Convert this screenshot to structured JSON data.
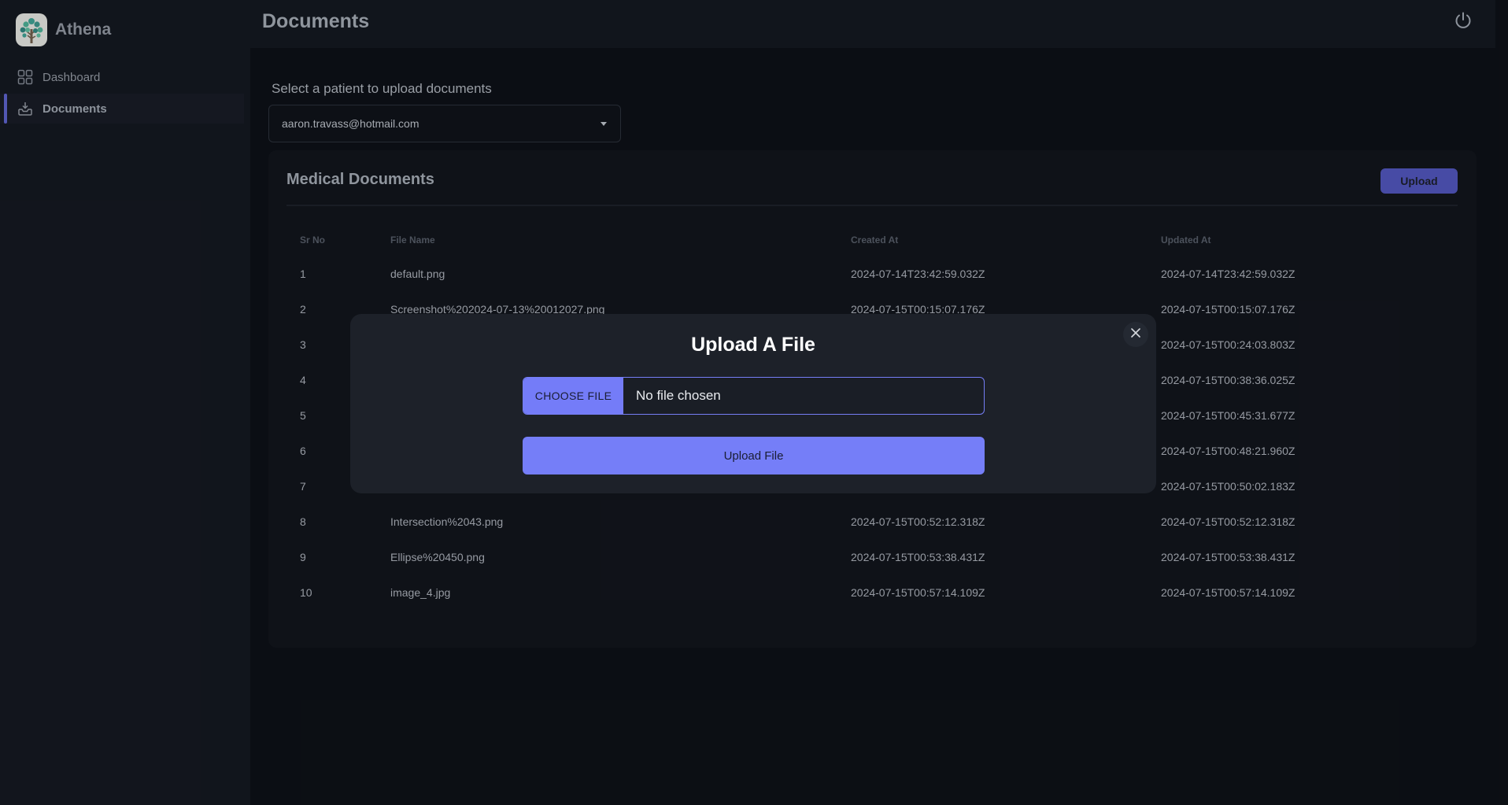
{
  "app": {
    "name": "Athena"
  },
  "sidebar": {
    "items": [
      {
        "label": "Dashboard",
        "icon": "grid-icon",
        "active": false
      },
      {
        "label": "Documents",
        "icon": "inbox-icon",
        "active": true
      }
    ]
  },
  "header": {
    "title": "Documents",
    "power_icon": "power-icon"
  },
  "patient_select": {
    "label": "Select a patient to upload documents",
    "value": "aaron.travass@hotmail.com"
  },
  "documents": {
    "title": "Medical Documents",
    "upload_label": "Upload",
    "columns": [
      "Sr No",
      "File Name",
      "Created At",
      "Updated At"
    ],
    "rows": [
      [
        "1",
        "default.png",
        "2024-07-14T23:42:59.032Z",
        "2024-07-14T23:42:59.032Z"
      ],
      [
        "2",
        "Screenshot%202024-07-13%20012027.png",
        "2024-07-15T00:15:07.176Z",
        "2024-07-15T00:15:07.176Z"
      ],
      [
        "3",
        "",
        "",
        "2024-07-15T00:24:03.803Z"
      ],
      [
        "4",
        "",
        "",
        "2024-07-15T00:38:36.025Z"
      ],
      [
        "5",
        "",
        "",
        "2024-07-15T00:45:31.677Z"
      ],
      [
        "6",
        "",
        "",
        "2024-07-15T00:48:21.960Z"
      ],
      [
        "7",
        "",
        "",
        "2024-07-15T00:50:02.183Z"
      ],
      [
        "8",
        "Intersection%2043.png",
        "2024-07-15T00:52:12.318Z",
        "2024-07-15T00:52:12.318Z"
      ],
      [
        "9",
        "Ellipse%20450.png",
        "2024-07-15T00:53:38.431Z",
        "2024-07-15T00:53:38.431Z"
      ],
      [
        "10",
        "image_4.jpg",
        "2024-07-15T00:57:14.109Z",
        "2024-07-15T00:57:14.109Z"
      ]
    ]
  },
  "modal": {
    "title": "Upload A File",
    "choose_label": "CHOOSE FILE",
    "file_status": "No file chosen",
    "submit_label": "Upload File"
  },
  "colors": {
    "accent": "#757ef8",
    "accent_dark": "#4e52b3",
    "background": "#0d1016",
    "sidebar": "#13171f",
    "modal": "#1d2129"
  }
}
